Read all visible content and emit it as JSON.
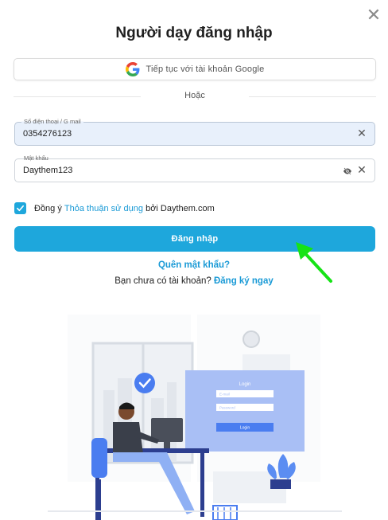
{
  "dialog": {
    "title": "Người dạy đăng nhập",
    "close_icon": "close-icon"
  },
  "google": {
    "label": "Tiếp tục với tài khoản Google",
    "icon": "google-icon"
  },
  "divider": {
    "text": "Hoặc"
  },
  "phone_field": {
    "label": "Số điện thoại / G mail",
    "value": "0354276123",
    "clear_icon": "clear-icon"
  },
  "password_field": {
    "label": "Mật khẩu",
    "value": "Daythem123",
    "eye_icon": "eye-off-icon",
    "clear_icon": "clear-icon"
  },
  "agreement": {
    "checked": true,
    "prefix": "Đồng ý ",
    "link": "Thỏa thuận sử dụng",
    "suffix": " bởi Daythem.com"
  },
  "login_button": {
    "label": "Đăng nhập"
  },
  "forgot_password": {
    "label": "Quên mật khẩu?"
  },
  "register": {
    "prompt": "Bạn chưa có tài khoản?",
    "link": "Đăng ký ngay"
  },
  "illustration": {
    "screen_title": "Login",
    "email_placeholder": "E-mail",
    "password_placeholder": "Password",
    "button": "Login"
  },
  "colors": {
    "primary": "#1ea7dc",
    "link": "#1a9ad6",
    "annotation_arrow": "#16e316"
  }
}
